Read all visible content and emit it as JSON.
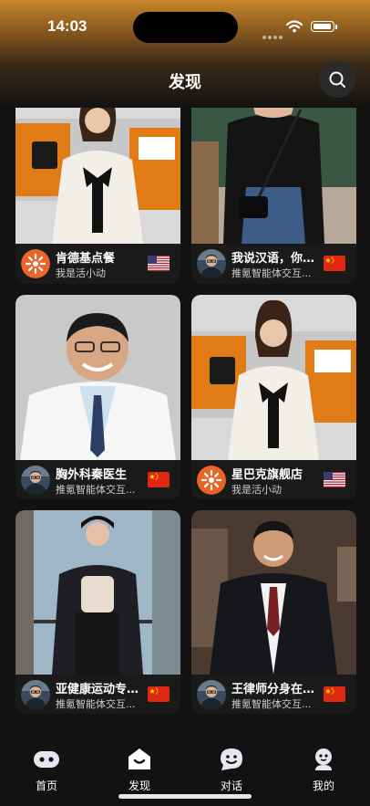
{
  "status": {
    "time": "14:03"
  },
  "header": {
    "title": "发现",
    "search_icon": "search-icon"
  },
  "colors": {
    "background": "#121212",
    "card": "#1a1a1a",
    "header_gold": "#c8862a"
  },
  "cards": [
    {
      "name": "肯德基点餐",
      "sub": "我是活小动",
      "avatar": "orange-logo-avatar",
      "flag": "us-flag"
    },
    {
      "name": "我说汉语，你...",
      "sub": "推氪智能体交互...",
      "avatar": "man-glasses-avatar",
      "flag": "cn-flag"
    },
    {
      "name": "胸外科秦医生",
      "sub": "推氪智能体交互...",
      "avatar": "man-glasses-avatar",
      "flag": "cn-flag"
    },
    {
      "name": "星巴克旗舰店",
      "sub": "我是活小动",
      "avatar": "orange-logo-avatar",
      "flag": "us-flag"
    },
    {
      "name": "亚健康运动专...",
      "sub": "推氪智能体交互...",
      "avatar": "man-glasses-avatar",
      "flag": "cn-flag"
    },
    {
      "name": "王律师分身在...",
      "sub": "推氪智能体交互...",
      "avatar": "man-glasses-avatar",
      "flag": "cn-flag"
    }
  ],
  "tabs": [
    {
      "label": "首页",
      "icon": "robot-icon"
    },
    {
      "label": "发现",
      "icon": "discover-home-icon"
    },
    {
      "label": "对话",
      "icon": "chat-face-icon"
    },
    {
      "label": "我的",
      "icon": "profile-icon"
    }
  ]
}
